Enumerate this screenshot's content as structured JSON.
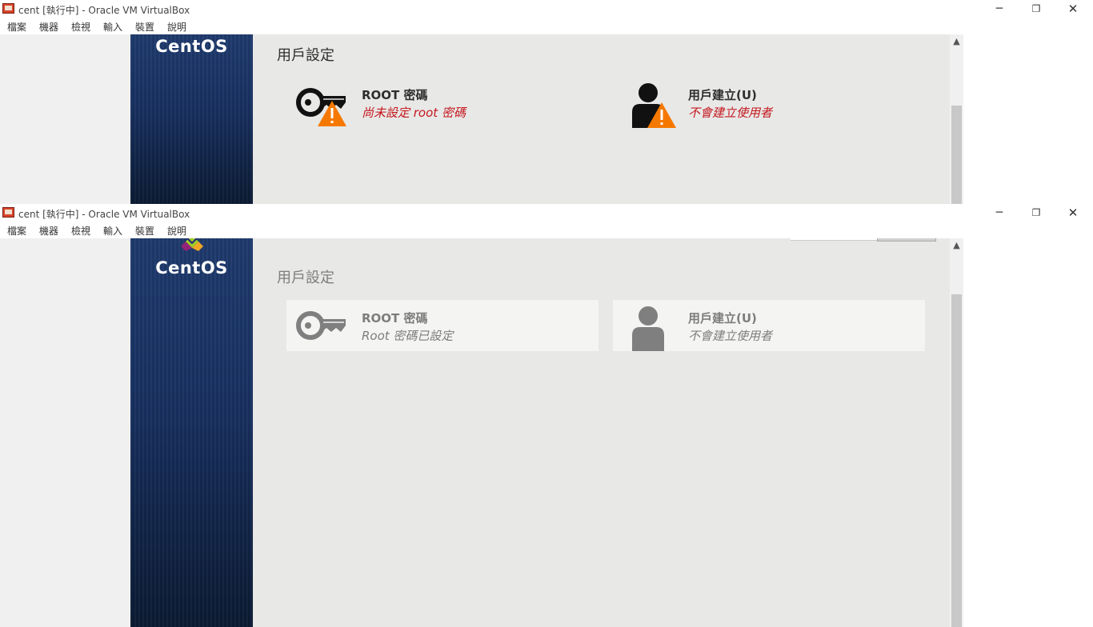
{
  "window": {
    "title": "cent [執行中] - Oracle VM VirtualBox",
    "menu": [
      "檔案",
      "機器",
      "檢視",
      "輸入",
      "裝置",
      "說明"
    ],
    "controls": {
      "minimize": "─",
      "maximize": "❐",
      "close": "✕"
    }
  },
  "guest": {
    "brand": "CentOS",
    "section_title": "用戶設定"
  },
  "top_state": {
    "root": {
      "name": "ROOT 密碼",
      "status": "尚未設定 root 密碼",
      "icon": "key-warning-icon"
    },
    "user": {
      "name": "用戶建立(U)",
      "status": "不會建立使用者",
      "icon": "user-warning-icon"
    }
  },
  "bottom_state": {
    "root": {
      "name": "ROOT 密碼",
      "status": "Root 密碼已設定",
      "icon": "key-icon"
    },
    "user": {
      "name": "用戶建立(U)",
      "status": "不會建立使用者",
      "icon": "user-icon"
    }
  },
  "colors": {
    "warning": "#f57900",
    "error_text": "#c4161c",
    "sidebar": "#1f3b6e",
    "background": "#e8e8e7"
  }
}
